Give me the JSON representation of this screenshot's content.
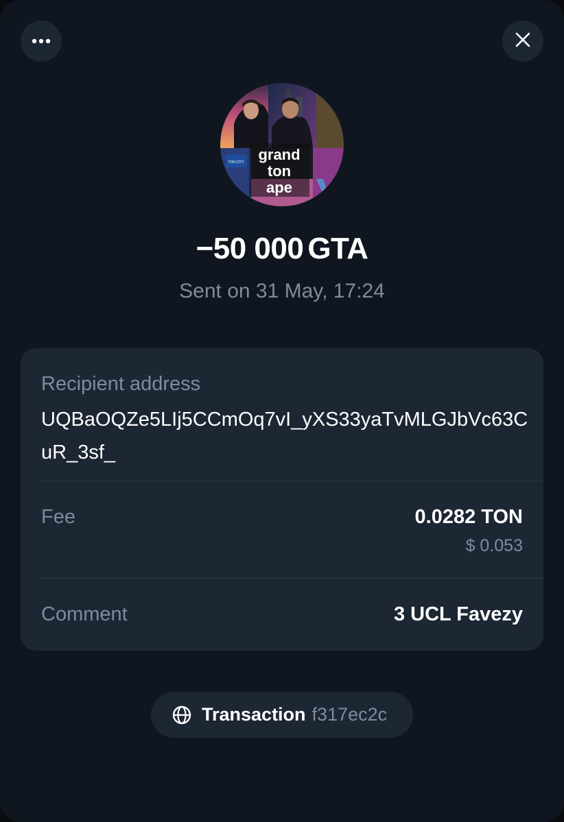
{
  "header": {
    "more_icon": "more-horizontal-icon",
    "close_icon": "close-icon"
  },
  "token": {
    "avatar_text": [
      "grand",
      "ton",
      "ape"
    ],
    "avatar_sign": "TON CITY"
  },
  "amount": {
    "sign": "−",
    "value": "50 000",
    "ticker": "GTA"
  },
  "status": "Sent on 31 May, 17:24",
  "details": {
    "recipient_label": "Recipient address",
    "recipient_address": "UQBaOQZe5LIj5CCmOq7vI_yXS33yaTvMLGJbVc63CuR_3sf_",
    "fee_label": "Fee",
    "fee_value": "0.0282 TON",
    "fee_usd": "$ 0.053",
    "comment_label": "Comment",
    "comment_value": "3 UCL Favezy"
  },
  "transaction": {
    "icon": "globe-icon",
    "label": "Transaction",
    "hash": "f317ec2c"
  },
  "colors": {
    "background": "#10161f",
    "card": "#1d2633",
    "muted_text": "#7f8b9c",
    "text": "#ffffff"
  }
}
